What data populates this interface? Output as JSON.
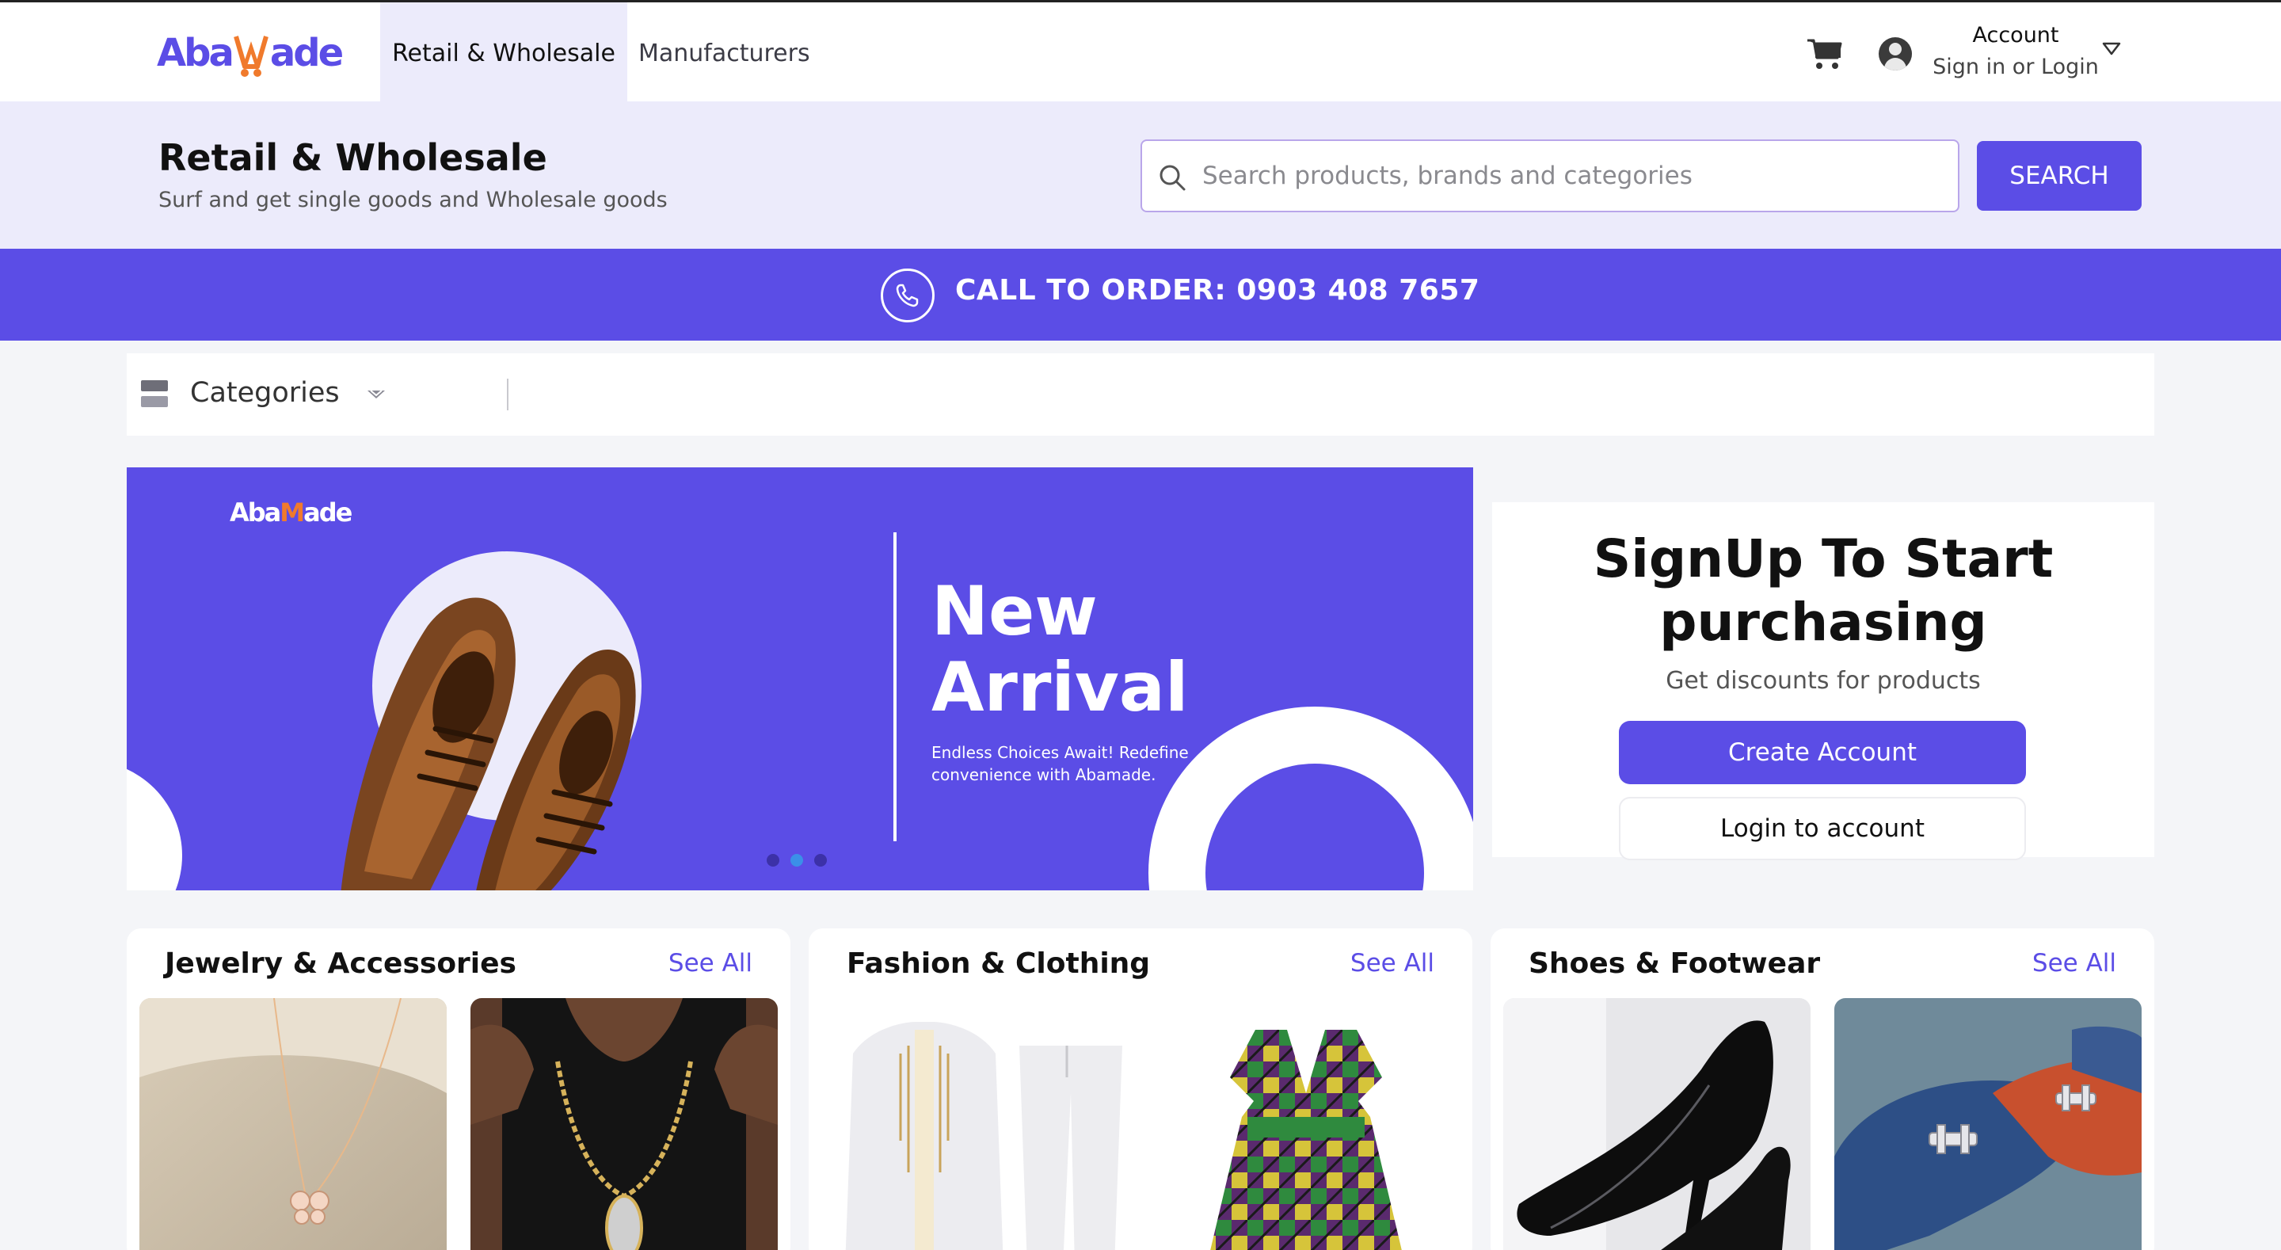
{
  "nav": {
    "logo_text": "AbaMade",
    "tabs": [
      {
        "label": "Retail & Wholesale",
        "active": true
      },
      {
        "label": "Manufacturers",
        "active": false
      }
    ],
    "account_title": "Account",
    "account_sub": "Sign in or Login"
  },
  "header": {
    "title": "Retail & Wholesale",
    "subtitle": "Surf and get single goods and Wholesale goods",
    "search_placeholder": "Search products, brands and categories",
    "search_value": "",
    "search_button": "SEARCH"
  },
  "callbar": {
    "text": "CALL TO ORDER: 0903 408 7657"
  },
  "categories": {
    "label": "Categories"
  },
  "banner": {
    "logo_text": "AbaMade",
    "title_line1": "New",
    "title_line2": "Arrival",
    "description": "Endless Choices Await! Redefine convenience with Abamade.",
    "slide_count": 3,
    "active_slide": 2
  },
  "signup": {
    "title_line1": "SignUp To Start",
    "title_line2": "purchasing",
    "subtitle": "Get discounts for products",
    "create_button": "Create Account",
    "login_button": "Login to account"
  },
  "sections": [
    {
      "title": "Jewelry & Accessories",
      "see_all": "See All"
    },
    {
      "title": "Fashion & Clothing",
      "see_all": "See All"
    },
    {
      "title": "Shoes & Footwear",
      "see_all": "See All"
    }
  ],
  "colors": {
    "brand": "#5b4de6",
    "brand_light": "#ecebfb",
    "accent_orange": "#f07a2c"
  }
}
